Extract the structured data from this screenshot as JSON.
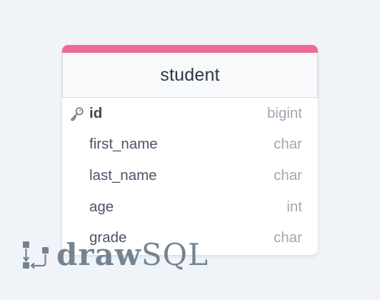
{
  "table": {
    "name": "student",
    "accent_color": "#f06a96",
    "columns": [
      {
        "name": "id",
        "type": "bigint",
        "primary_key": true,
        "icon": "key-icon"
      },
      {
        "name": "first_name",
        "type": "char",
        "primary_key": false
      },
      {
        "name": "last_name",
        "type": "char",
        "primary_key": false
      },
      {
        "name": "age",
        "type": "int",
        "primary_key": false
      },
      {
        "name": "grade",
        "type": "char",
        "primary_key": false
      }
    ]
  },
  "watermark": {
    "brand_bold": "draw",
    "brand_light": "SQL",
    "icon": "drawsql-logo-icon"
  }
}
